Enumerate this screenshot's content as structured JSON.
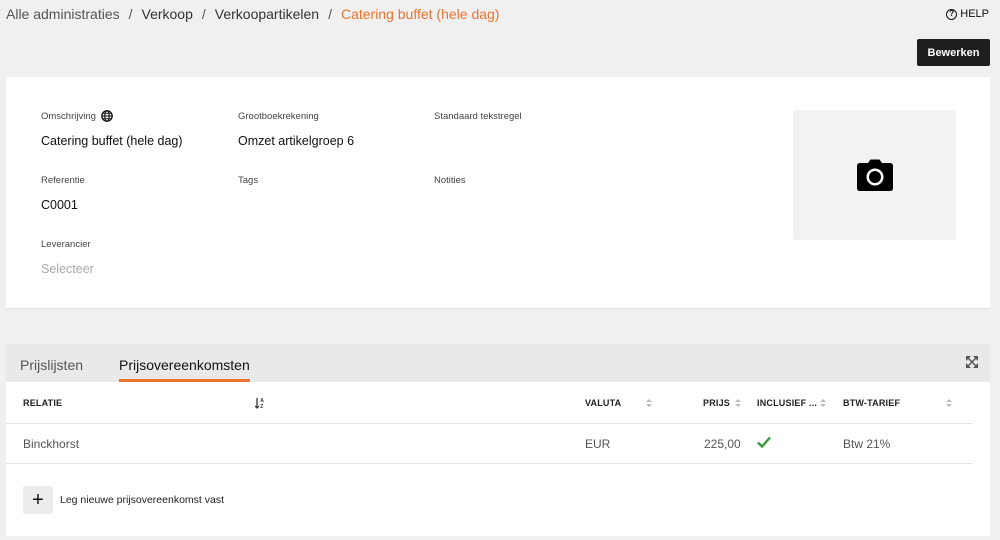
{
  "breadcrumb": {
    "items": [
      "Alle administraties",
      "Verkoop",
      "Verkoopartikelen"
    ],
    "current": "Catering buffet (hele dag)",
    "separator": "/"
  },
  "help": {
    "icon": "?",
    "label": "HELP"
  },
  "toolbar": {
    "edit_label": "Bewerken"
  },
  "details": {
    "omschrijving": {
      "label": "Omschrijving",
      "value": "Catering buffet (hele dag)"
    },
    "referentie": {
      "label": "Referentie",
      "value": "C0001"
    },
    "leverancier": {
      "label": "Leverancier",
      "placeholder": "Selecteer"
    },
    "grootboekrekening": {
      "label": "Grootboekrekening",
      "value": "Omzet artikelgroep 6"
    },
    "tags": {
      "label": "Tags"
    },
    "standaard_tekstregel": {
      "label": "Standaard tekstregel"
    },
    "notities": {
      "label": "Notities"
    }
  },
  "tabs": [
    {
      "label": "Prijslijsten",
      "active": false
    },
    {
      "label": "Prijsovereenkomsten",
      "active": true
    }
  ],
  "table": {
    "columns": [
      "RELATIE",
      "VALUTA",
      "PRIJS",
      "INCLUSIEF ...",
      "BTW-TARIEF"
    ],
    "rows": [
      {
        "relatie": "Binckhorst",
        "valuta": "EUR",
        "prijs": "225,00",
        "inclusief": true,
        "btw": "Btw 21%"
      }
    ],
    "add_icon": "+",
    "add_label": "Leg nieuwe prijsovereenkomst vast"
  },
  "colors": {
    "accent": "#e87530",
    "check": "#3a9a3a",
    "button_dark": "#1e1e1e"
  }
}
